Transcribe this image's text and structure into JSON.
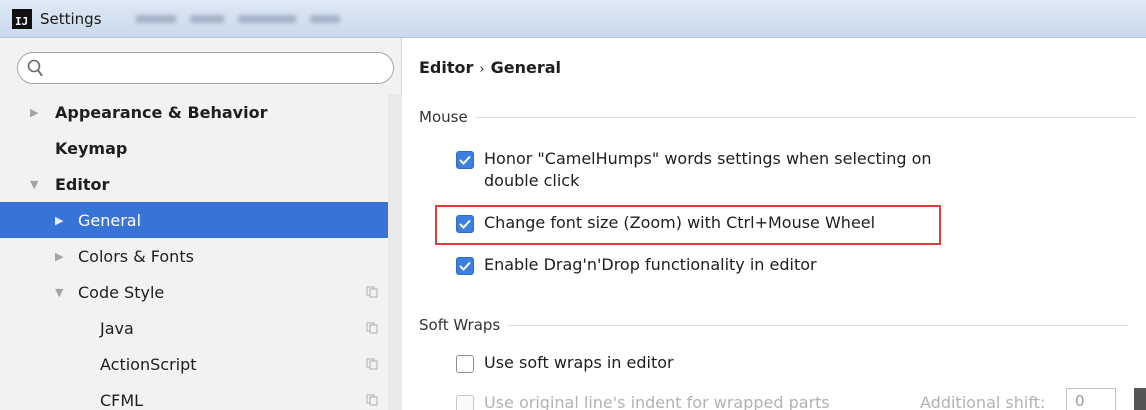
{
  "window": {
    "title": "Settings",
    "app_icon": "IJ"
  },
  "search": {
    "placeholder": ""
  },
  "tree": [
    {
      "label": "Appearance & Behavior",
      "bold": true,
      "arrow": "▶",
      "selected": false
    },
    {
      "label": "Keymap",
      "bold": true,
      "arrow": "",
      "selected": false
    },
    {
      "label": "Editor",
      "bold": true,
      "arrow": "▼",
      "selected": false
    },
    {
      "label": "General",
      "bold": false,
      "arrow": "▶",
      "selected": true
    },
    {
      "label": "Colors & Fonts",
      "bold": false,
      "arrow": "▶",
      "selected": false
    },
    {
      "label": "Code Style",
      "bold": false,
      "arrow": "▼",
      "selected": false,
      "copy_icon": true
    },
    {
      "label": "Java",
      "bold": false,
      "arrow": "",
      "selected": false,
      "copy_icon": true
    },
    {
      "label": "ActionScript",
      "bold": false,
      "arrow": "",
      "selected": false,
      "copy_icon": true
    },
    {
      "label": "CFML",
      "bold": false,
      "arrow": "",
      "selected": false,
      "copy_icon": true
    }
  ],
  "breadcrumb": {
    "parent": "Editor",
    "separator": "›",
    "current": "General"
  },
  "sections": {
    "mouse": {
      "title": "Mouse",
      "options": [
        {
          "label_line1": "Honor \"CamelHumps\" words settings when selecting on",
          "label_line2": "double click",
          "checked": true
        },
        {
          "label": "Change font size (Zoom) with Ctrl+Mouse Wheel",
          "checked": true,
          "highlighted": true
        },
        {
          "label": "Enable Drag'n'Drop functionality in editor",
          "checked": true
        }
      ]
    },
    "soft_wraps": {
      "title": "Soft Wraps",
      "options": [
        {
          "label": "Use soft wraps in editor",
          "checked": false
        },
        {
          "label": "Use original line's indent for wrapped parts",
          "checked": false,
          "disabled": true
        }
      ],
      "additional_shift": {
        "label": "Additional shift:",
        "value": "0"
      }
    }
  },
  "colors": {
    "selection": "#3874d8",
    "checkbox": "#3c7fe0",
    "highlight_border": "#e23c3c"
  }
}
